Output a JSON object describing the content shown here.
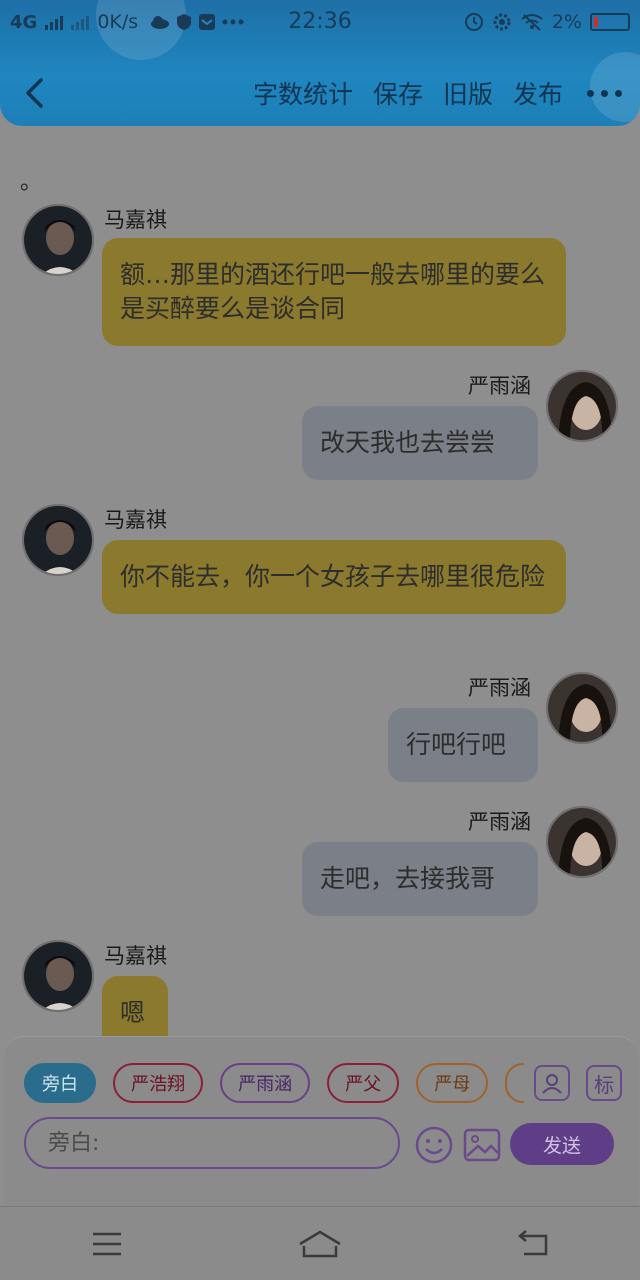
{
  "status_bar": {
    "network": "4G",
    "speed": "0K/s",
    "time": "22:36",
    "battery": "2%",
    "icons": [
      "cloud-icon",
      "shield-icon",
      "mail-icon",
      "ellipsis-icon",
      "alarm-icon",
      "gear-icon",
      "wifi-off-icon"
    ]
  },
  "header": {
    "back_icon": "chevron-left-icon",
    "actions": {
      "word_count": "字数统计",
      "save": "保存",
      "old_version": "旧版",
      "publish": "发布"
    },
    "more_icon": "more-dots-icon"
  },
  "chat": {
    "narration": "。",
    "messages": [
      {
        "speaker": "马嘉祺",
        "side": "left",
        "text": "额…那里的酒还行吧一般去哪里的要么是买醉要么是谈合同"
      },
      {
        "speaker": "严雨涵",
        "side": "right",
        "text": "改天我也去尝尝"
      },
      {
        "speaker": "马嘉祺",
        "side": "left",
        "text": "你不能去，你一个女孩子去哪里很危险"
      },
      {
        "speaker": "严雨涵",
        "side": "right",
        "text": "行吧行吧"
      },
      {
        "speaker": "严雨涵",
        "side": "right",
        "text": "走吧，去接我哥"
      },
      {
        "speaker": "马嘉祺",
        "side": "left",
        "text": "嗯"
      }
    ]
  },
  "input_panel": {
    "roles": [
      "旁白",
      "严浩翔",
      "严雨涵",
      "严父",
      "严母"
    ],
    "active_role": "旁白",
    "role_icon_label": "角色",
    "mark_icon_label": "标",
    "placeholder": "旁白:",
    "value": "",
    "send_label": "发送"
  },
  "system_nav": {
    "buttons": [
      "menu-icon",
      "home-icon",
      "back-icon"
    ]
  },
  "colors": {
    "header": "#1f86bf",
    "left_bubble": "#8b7a2d",
    "right_bubble": "#7a7f88",
    "accent_purple": "#5f3d87"
  }
}
